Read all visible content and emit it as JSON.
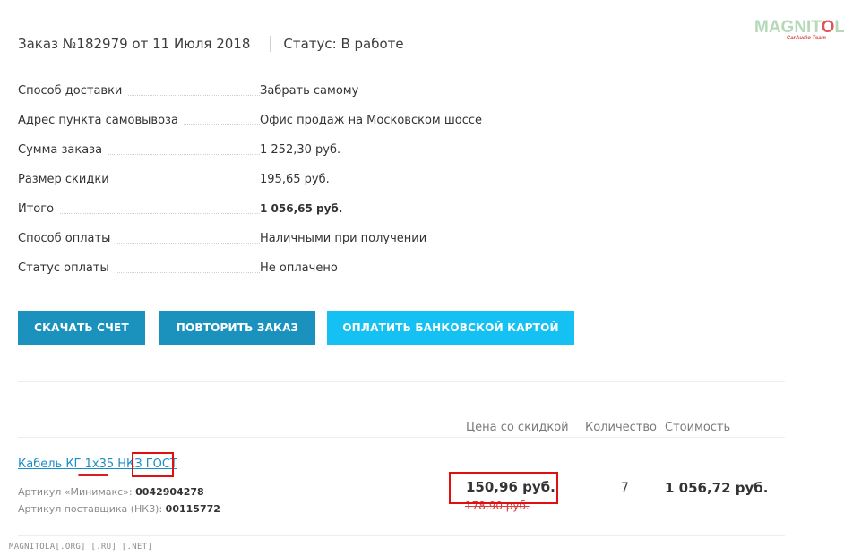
{
  "header": {
    "order_title": "Заказ №182979 от 11 Июля 2018",
    "status": "Статус: В работе"
  },
  "watermark": {
    "logo_text_before": "MAGNIT",
    "logo_text_o": "O",
    "logo_text_after": "LA",
    "logo_subtext": "CarAudio Team",
    "footer": "MAGNITOLA[.ORG] [.RU] [.NET]",
    "accent_color": "#e05656"
  },
  "info": {
    "rows": [
      {
        "label": "Способ доставки",
        "value": "Забрать самому"
      },
      {
        "label": "Адрес пункта самовывоза",
        "value": "Офис продаж на Московском шоссе"
      },
      {
        "label": "Сумма заказа",
        "value": "1 252,30 руб."
      },
      {
        "label": "Размер скидки",
        "value": "195,65 руб."
      },
      {
        "label": "Итого",
        "value": "1 056,65 руб."
      },
      {
        "label": "Способ оплаты",
        "value": "Наличными при получении"
      },
      {
        "label": "Статус оплаты",
        "value": "Не оплачено"
      }
    ]
  },
  "buttons": {
    "download_invoice": "СКАЧАТЬ СЧЕТ",
    "repeat_order": "ПОВТОРИТЬ ЗАКАЗ",
    "pay_card": "ОПЛАТИТЬ БАНКОВСКОЙ КАРТОЙ",
    "dark_color": "#1b91be",
    "light_color": "#14c1f2"
  },
  "table": {
    "columns": {
      "price_discount": "Цена со скидкой",
      "quantity": "Количество",
      "cost": "Стоимость"
    },
    "items": [
      {
        "name_main": "Кабель КГ 1х35 НКЗ",
        "name_tail": "ГОСТ",
        "article_label": "Артикул «Минимакс»:",
        "article_value": "0042904278",
        "supplier_label": "Артикул поставщика (НКЗ):",
        "supplier_value": "00115772",
        "price": "150,96 руб.",
        "old_price": "178,90 руб.",
        "quantity": "7",
        "cost": "1 056,72 руб."
      }
    ]
  }
}
